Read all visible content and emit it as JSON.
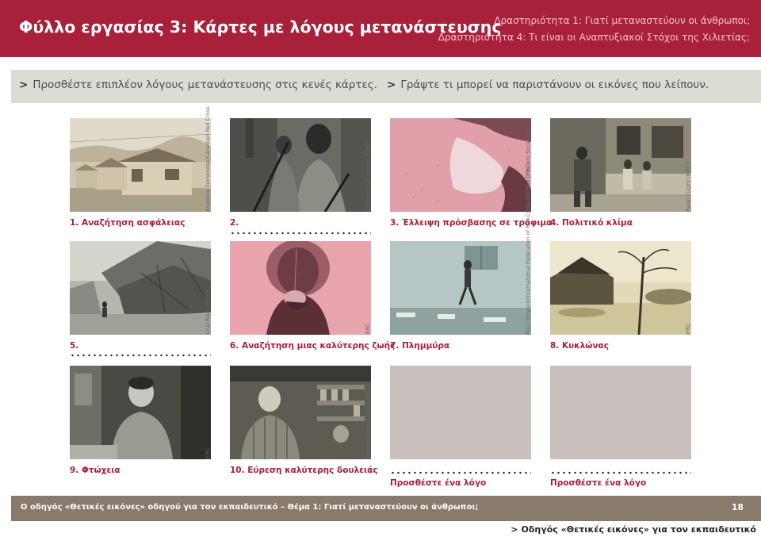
{
  "header": {
    "title": "Φύλλο εργασίας 3: Κάρτες με λόγους μετανάστευσης",
    "activity_1": "Δραστηριότητα 1: Γιατί μεταναστεύουν οι άνθρωποι;",
    "activity_4": "Δραστηριότητα 4: Τι είναι οι Αναπτυξιακοί Στόχοι της Χιλιετίας;"
  },
  "instructions": {
    "marker": ">",
    "left": "Προσθέστε επιπλέον λόγους μετανάστευσης στις κενές κάρτες.",
    "right": "Γράψτε τι μπορεί να παριστάνουν οι εικόνες που λείπουν."
  },
  "cards": [
    {
      "caption": "1. Αναζήτηση ασφάλειας",
      "credit": "Angeline Sumendap/Canadian Red Cross"
    },
    {
      "caption": "2.",
      "credit": "Anthony Tian Voeten (ICRC)"
    },
    {
      "caption": "3. Έλλειψη πρόσβασης σε τρόφιμα",
      "credit": "Jose Cendon (IFRC)"
    },
    {
      "caption": "4. Πολιτικό κλίμα",
      "credit": "Pavel Cugini (ICRC)"
    },
    {
      "caption": "5.",
      "credit": "Cruz Roja Chilena"
    },
    {
      "caption": "6. Αναζήτηση μιας καλύτερης ζωής",
      "credit": "IFRC"
    },
    {
      "caption": "7. Πλημμύρα",
      "credit": "Ricci Shryock/International Federation of Red Cross and Red Crescent Societies"
    },
    {
      "caption": "8. Κυκλώνας",
      "credit": "IFRC"
    },
    {
      "caption": "9. Φτώχεια",
      "credit": "IFRC"
    },
    {
      "caption": "10. Εύρεση καλύτερης δουλειάς",
      "credit": "Gemunu Amarasinghe (IRCS)"
    },
    {
      "caption": "Προσθέστε ένα λόγο",
      "credit": ""
    },
    {
      "caption": "Προσθέστε ένα λόγο",
      "credit": ""
    }
  ],
  "footer": {
    "text": "Ο οδηγός «Θετικές εικόνες» οδηγού για τον εκπαιδευτικό – Θέμα 1: Γιατί μεταναστεύουν οι άνθρωποι;",
    "page": "18"
  },
  "bottom_link": {
    "marker": ">",
    "text": "Οδηγός «Θετικές εικόνες» για τον εκπαιδευτικό"
  },
  "colors": {
    "brand": "#a8203a",
    "instructions_bg": "#dcdcd5",
    "footer_bg": "#8a7a6c",
    "placeholder_card": "#c8c0bc",
    "pink_photo": "#e7a4ad"
  }
}
